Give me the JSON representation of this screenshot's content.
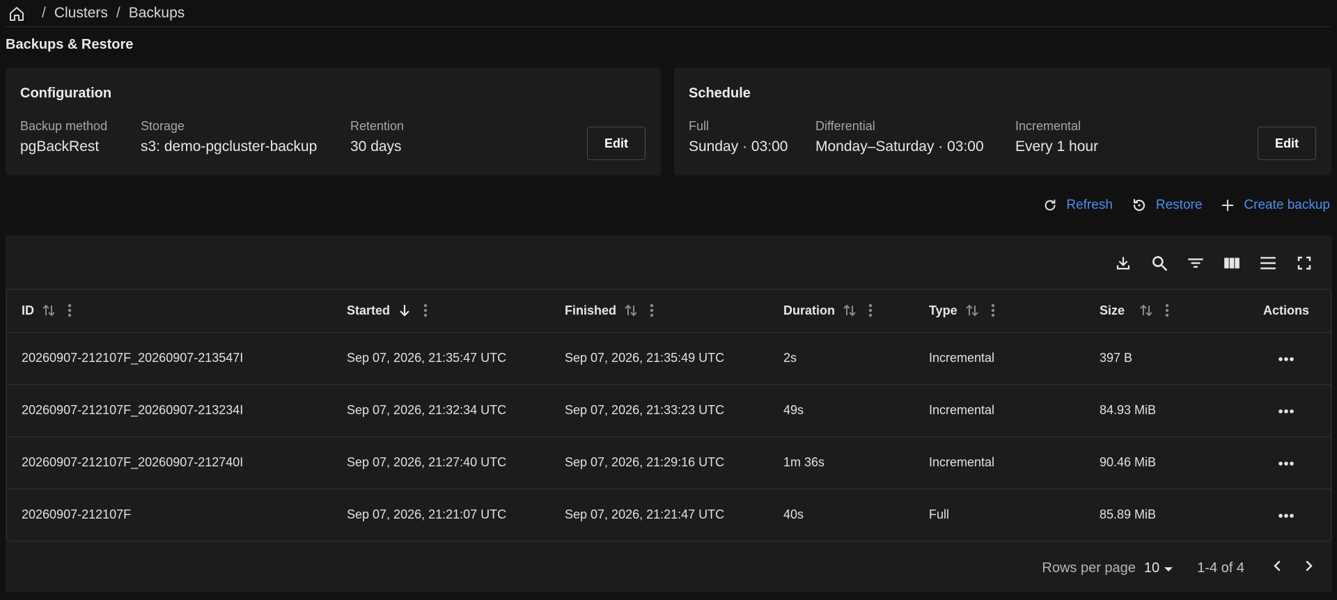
{
  "breadcrumb": {
    "items": [
      "Clusters",
      "Backups"
    ],
    "separator": "/"
  },
  "page_title": "Backups & Restore",
  "configuration": {
    "title": "Configuration",
    "fields": [
      {
        "label": "Backup method",
        "value": "pgBackRest"
      },
      {
        "label": "Storage",
        "value": "s3: demo-pgcluster-backup"
      },
      {
        "label": "Retention",
        "value": "30 days"
      }
    ],
    "edit_label": "Edit"
  },
  "schedule": {
    "title": "Schedule",
    "fields": [
      {
        "label": "Full",
        "value": "Sunday · 03:00"
      },
      {
        "label": "Differential",
        "value": "Monday–Saturday · 03:00"
      },
      {
        "label": "Incremental",
        "value": "Every 1 hour"
      }
    ],
    "edit_label": "Edit"
  },
  "actions": {
    "refresh": "Refresh",
    "restore": "Restore",
    "create": "Create backup"
  },
  "colors": {
    "accent": "#4d8ef0",
    "background": "#111111",
    "surface": "#1c1c1c"
  },
  "table": {
    "columns": [
      "ID",
      "Started",
      "Finished",
      "Duration",
      "Type",
      "Size",
      "Actions"
    ],
    "rows": [
      {
        "id": "20260907-212107F_20260907-213547I",
        "started": "Sep 07, 2026, 21:35:47 UTC",
        "finished": "Sep 07, 2026, 21:35:49 UTC",
        "duration": "2s",
        "type": "Incremental",
        "size": "397 B"
      },
      {
        "id": "20260907-212107F_20260907-213234I",
        "started": "Sep 07, 2026, 21:32:34 UTC",
        "finished": "Sep 07, 2026, 21:33:23 UTC",
        "duration": "49s",
        "type": "Incremental",
        "size": "84.93 MiB"
      },
      {
        "id": "20260907-212107F_20260907-212740I",
        "started": "Sep 07, 2026, 21:27:40 UTC",
        "finished": "Sep 07, 2026, 21:29:16 UTC",
        "duration": "1m 36s",
        "type": "Incremental",
        "size": "90.46 MiB"
      },
      {
        "id": "20260907-212107F",
        "started": "Sep 07, 2026, 21:21:07 UTC",
        "finished": "Sep 07, 2026, 21:21:47 UTC",
        "duration": "40s",
        "type": "Full",
        "size": "85.89 MiB"
      }
    ]
  },
  "pagination": {
    "rows_per_page_label": "Rows per page",
    "rows_per_page": "10",
    "range": "1-4 of 4"
  }
}
